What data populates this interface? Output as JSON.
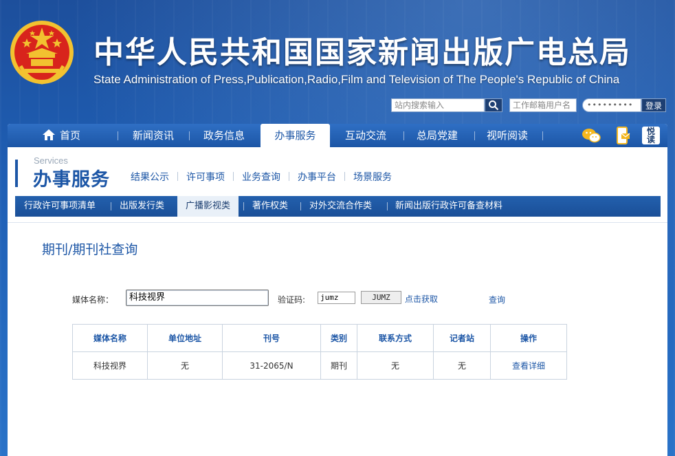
{
  "header": {
    "title_cn": "中华人民共和国国家新闻出版广电总局",
    "title_en": "State Administration of Press,Publication,Radio,Film and Television of The People's Republic of China",
    "search_placeholder": "站内搜索输入",
    "mail_placeholder": "工作邮箱用户名",
    "password_mask": "•••••••••",
    "login_label": "登录"
  },
  "main_nav": {
    "items": [
      {
        "label": "首页"
      },
      {
        "label": "新闻资讯"
      },
      {
        "label": "政务信息"
      },
      {
        "label": "办事服务"
      },
      {
        "label": "互动交流"
      },
      {
        "label": "总局党建"
      },
      {
        "label": "视听阅读"
      }
    ],
    "active_index": 3,
    "icons": [
      "wechat-icon",
      "mobile-mail-icon",
      "yuedu-icon"
    ],
    "yuedu_label": "悦读"
  },
  "services": {
    "label_en": "Services",
    "label_cn": "办事服务",
    "subnav": [
      "结果公示",
      "许可事项",
      "业务查询",
      "办事平台",
      "场景服务"
    ]
  },
  "categories": {
    "items": [
      "行政许可事项清单",
      "出版发行类",
      "广播影视类",
      "著作权类",
      "对外交流合作类",
      "新闻出版行政许可备查材料"
    ],
    "active_index": 2
  },
  "page": {
    "title": "期刊/期刊社查询"
  },
  "form": {
    "media_label": "媒体名称：",
    "media_value": "科技视界",
    "captcha_label": "验证码:",
    "captcha_value": "jumz",
    "captcha_image_text": "JUMZ",
    "refresh_link": "点击获取",
    "query_link": "查询"
  },
  "table": {
    "headers": [
      "媒体名称",
      "单位地址",
      "刊号",
      "类别",
      "联系方式",
      "记者站",
      "操作"
    ],
    "rows": [
      [
        "科技视界",
        "无",
        "31-2065/N",
        "期刊",
        "无",
        "无",
        "查看详细"
      ]
    ]
  },
  "colors": {
    "brand_blue": "#1c56a6",
    "nav_top": "#2f6fc4",
    "emblem_red": "#d8241c",
    "emblem_gold": "#f2c230"
  }
}
